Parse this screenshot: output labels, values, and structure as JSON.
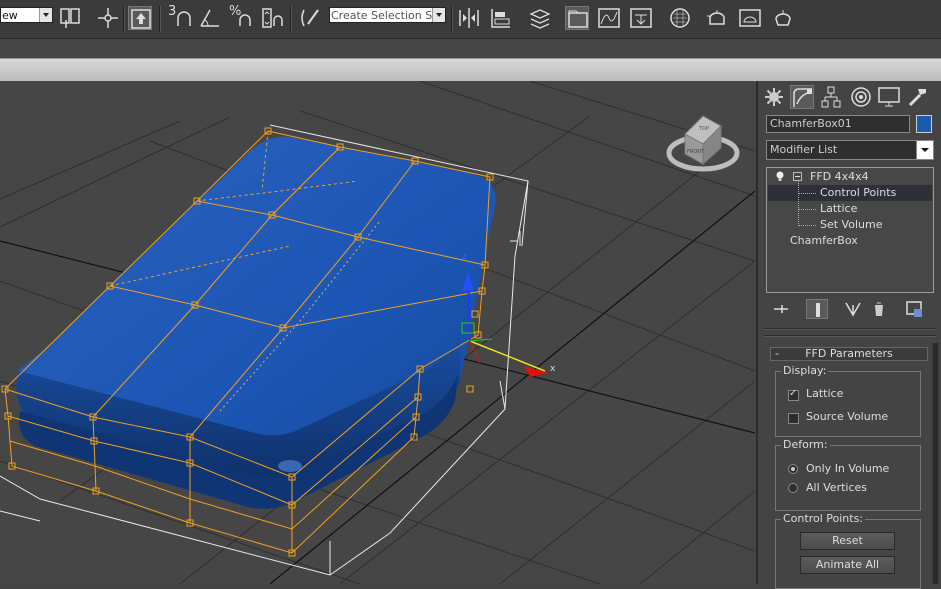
{
  "toolbar": {
    "view_select": "ew",
    "numeric_labels": {
      "snap": "3",
      "percent": "%"
    },
    "named_selection": {
      "placeholder": "Create Selection Set"
    }
  },
  "command_panel": {
    "tabs": [
      "create-icon",
      "modify-icon",
      "hierarchy-icon",
      "motion-icon",
      "display-icon",
      "utilities-icon"
    ],
    "active_tab": "modify",
    "object_name": "ChamferBox01",
    "object_color": "#1c5ab0",
    "modifier_list_label": "Modifier List",
    "stack": [
      {
        "label": "FFD 4x4x4",
        "level": 0,
        "expanded": true
      },
      {
        "label": "Control Points",
        "level": 1,
        "selected": true
      },
      {
        "label": "Lattice",
        "level": 1
      },
      {
        "label": "Set Volume",
        "level": 1
      },
      {
        "label": "ChamferBox",
        "level": 0
      }
    ],
    "rollout": {
      "minus": "-",
      "title": "FFD Parameters",
      "display": {
        "title": "Display:",
        "lattice": {
          "label": "Lattice",
          "checked": true
        },
        "source_volume": {
          "label": "Source Volume",
          "checked": false
        }
      },
      "deform": {
        "title": "Deform:",
        "only_in_volume": {
          "label": "Only In Volume",
          "selected": true
        },
        "all_vertices": {
          "label": "All Vertices",
          "selected": false
        }
      },
      "control_points": {
        "title": "Control Points:",
        "reset": "Reset",
        "animate_all": "Animate All"
      }
    }
  },
  "viewport": {
    "gizmo_labels": {
      "z": "z",
      "x": "x"
    },
    "viewcube_faces": {
      "top": "TOP",
      "front": "FRONT"
    },
    "object_color": "#1a4fa3",
    "lattice_color": "#f0a020"
  }
}
